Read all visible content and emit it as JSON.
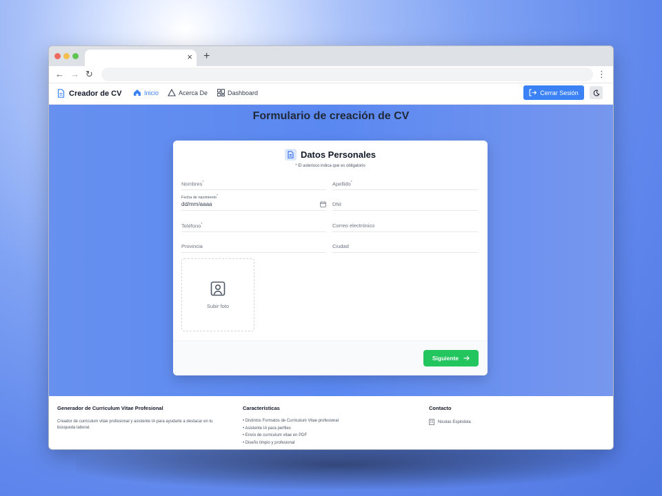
{
  "browser": {
    "close_tab": "×",
    "new_tab": "+",
    "back": "←",
    "forward": "→",
    "reload": "↻",
    "menu": "⋮"
  },
  "nav": {
    "brand": "Creador de CV",
    "links": [
      {
        "label": "Inicio",
        "icon": "home-icon",
        "active": true
      },
      {
        "label": "Acerca De",
        "icon": "triangle-icon",
        "active": false
      },
      {
        "label": "Dashboard",
        "icon": "grid-icon",
        "active": false
      }
    ],
    "logout_label": "Cerrar Sesión",
    "theme_icon": "moon-icon",
    "accent": "#3b82f6"
  },
  "page": {
    "title": "Formulario de creación de CV"
  },
  "form": {
    "section_title": "Datos Personales",
    "note": "* El asterisco indica que es obligatorio",
    "fields": {
      "nombres": {
        "label": "Nombres",
        "required": "*"
      },
      "apellido": {
        "label": "Apellido",
        "required": "*"
      },
      "fecha": {
        "label": "Fecha de nacimiento",
        "required": "*",
        "value": "dd/mm/aaaa"
      },
      "dni": {
        "label": "DNI"
      },
      "telefono": {
        "label": "Teléfono",
        "required": "*"
      },
      "correo": {
        "label": "Correo electrónico"
      },
      "provincia": {
        "label": "Provincia"
      },
      "ciudad": {
        "label": "Ciudad"
      }
    },
    "photo_label": "Subir foto",
    "next_label": "Siguiente",
    "next_color": "#22c55e"
  },
  "footer": {
    "about": {
      "title": "Generador de Curriculum Vitae Profesional",
      "text": "Creador de curriculum vitae profesional y asistente IA para ayudarte a destacar en tu búsqueda laboral."
    },
    "features": {
      "title": "Características",
      "items": [
        "• Distintos Formatos de Curriculum Vitae profesional",
        "• Asistente IA para perfiles",
        "• Envío de curriculum vitae en PDF",
        "• Diseño limpio y profesional"
      ]
    },
    "contact": {
      "title": "Contacto",
      "name": "Nicolas Espindola"
    }
  }
}
